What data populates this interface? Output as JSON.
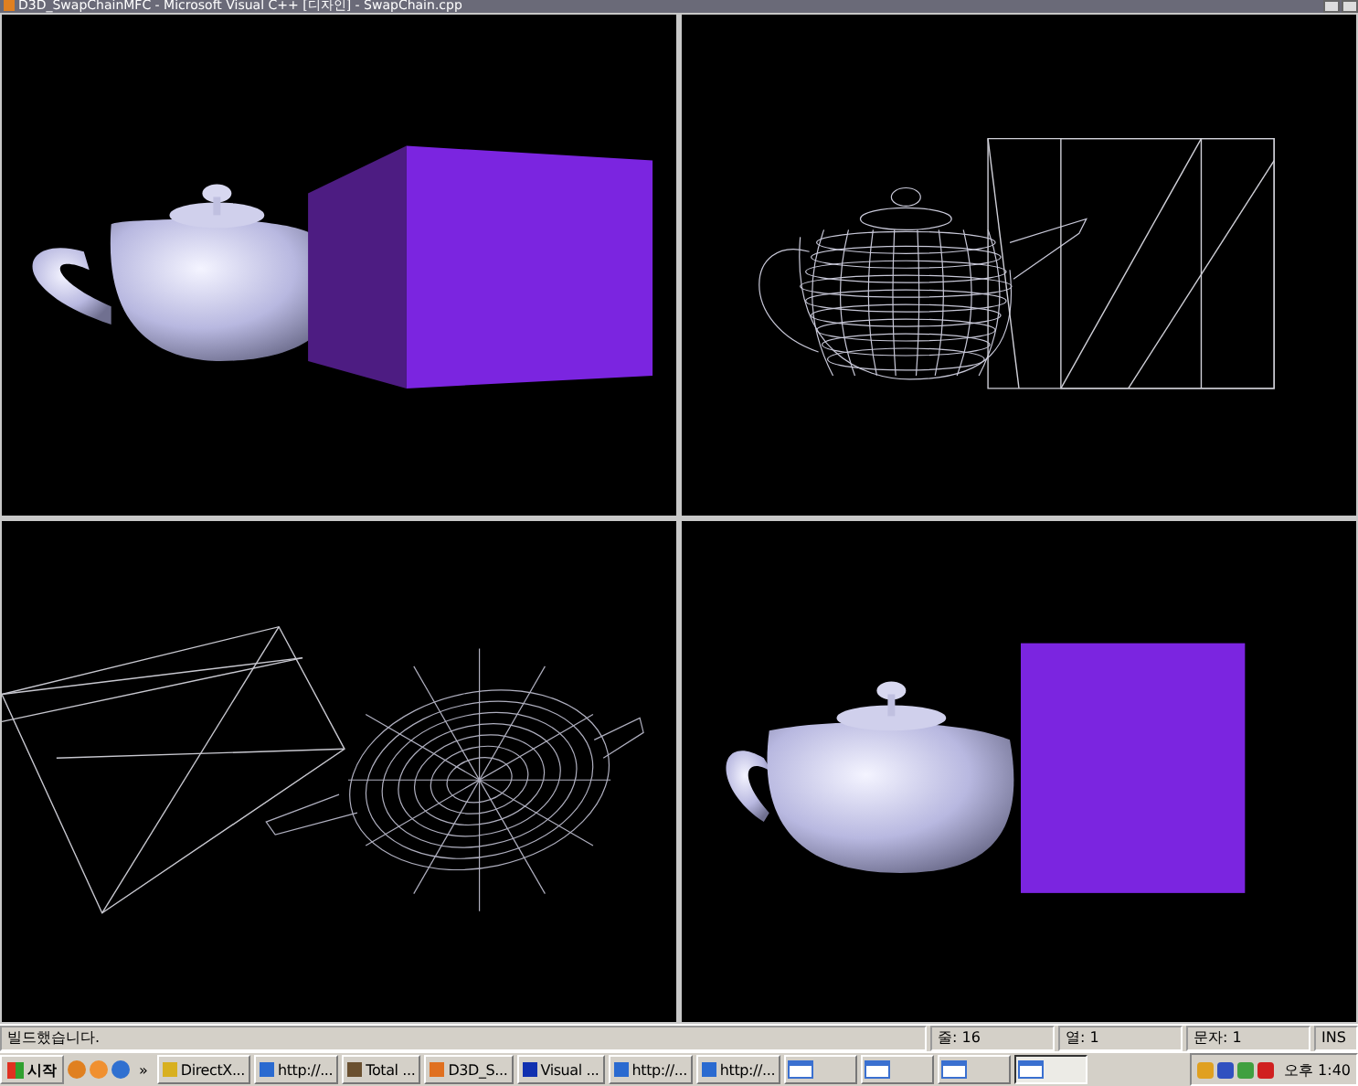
{
  "window": {
    "title": "D3D_SwapChainMFC - Microsoft Visual C++ [디자인] - SwapChain.cpp"
  },
  "viewports": [
    {
      "kind": "solid_perspective"
    },
    {
      "kind": "wireframe_front"
    },
    {
      "kind": "wireframe_rotated"
    },
    {
      "kind": "solid_front"
    }
  ],
  "status_bar": {
    "message": "빌드했습니다.",
    "line": "줄: 16",
    "column": "열: 1",
    "char": "문자: 1",
    "mode": "INS"
  },
  "taskbar": {
    "start": "시작",
    "more": "»",
    "tasks": [
      {
        "label": "DirectX...",
        "kind": "help",
        "selected": false
      },
      {
        "label": "http://...",
        "kind": "browser",
        "selected": false
      },
      {
        "label": "Total ...",
        "kind": "disk",
        "selected": false
      },
      {
        "label": "D3D_S...",
        "kind": "app",
        "selected": false
      },
      {
        "label": "Visual ...",
        "kind": "info",
        "selected": false
      },
      {
        "label": "http://...",
        "kind": "browser",
        "selected": false
      },
      {
        "label": "http://...",
        "kind": "browser",
        "selected": false
      },
      {
        "kind": "window",
        "selected": false
      },
      {
        "kind": "window",
        "selected": false
      },
      {
        "kind": "window",
        "selected": false
      },
      {
        "kind": "window",
        "selected": true
      }
    ],
    "clock": "오후 1:40"
  }
}
